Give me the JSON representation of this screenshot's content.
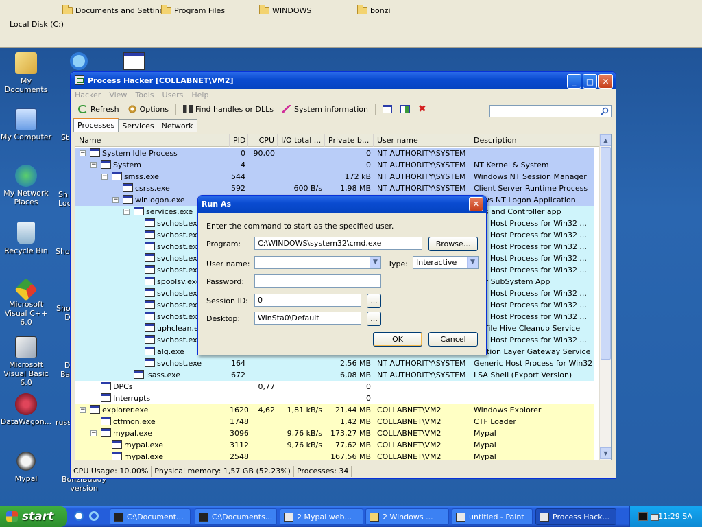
{
  "bg_explorer": {
    "folders": [
      "Documents and Settings",
      "Program Files",
      "WINDOWS",
      "bonzi"
    ],
    "local_disk": "Local Disk (C:)"
  },
  "desktop_icons": [
    {
      "label": "My Documents",
      "icon": "my-documents-icon"
    },
    {
      "label": "My Computer",
      "icon": "my-computer-icon"
    },
    {
      "label": "My Network Places",
      "icon": "network-places-icon"
    },
    {
      "label": "Recycle Bin",
      "icon": "recycle-bin-icon"
    },
    {
      "label": "Microsoft Visual C++ 6.0",
      "icon": "visual-cpp-icon"
    },
    {
      "label": "Microsoft Visual Basic 6.0",
      "icon": "visual-basic-icon"
    },
    {
      "label": "DataWagon...",
      "icon": "datawagon-icon"
    },
    {
      "label": "Mypal",
      "icon": "mypal-icon"
    }
  ],
  "partial_desktop_labels": {
    "st": "St",
    "sh_loc": "Sh\nLoc",
    "sho": "Sho",
    "sho_d": "Sho\nD",
    "d_ba": "D\nBa",
    "russ": "russ",
    "bonzi_version": "BonziBuddy\nversion"
  },
  "process_hacker": {
    "title": "Process Hacker [COLLABNET\\VM2]",
    "menu": [
      "Hacker",
      "View",
      "Tools",
      "Users",
      "Help"
    ],
    "toolbar": {
      "refresh": "Refresh",
      "options": "Options",
      "find_handles": "Find handles or DLLs",
      "system_info": "System information"
    },
    "search_placeholder": "",
    "tabs": [
      "Processes",
      "Services",
      "Network"
    ],
    "columns": [
      "Name",
      "PID",
      "CPU",
      "I/O total ...",
      "Private b...",
      "User name",
      "Description"
    ],
    "rows": [
      {
        "indent": 0,
        "toggle": "−",
        "name": "System Idle Process",
        "pid": "0",
        "cpu": "90,00",
        "io": "",
        "priv": "0",
        "user": "NT AUTHORITY\\SYSTEM",
        "desc": "",
        "bg": "blue"
      },
      {
        "indent": 1,
        "toggle": "−",
        "name": "System",
        "pid": "4",
        "cpu": "",
        "io": "",
        "priv": "0",
        "user": "NT AUTHORITY\\SYSTEM",
        "desc": "NT Kernel & System",
        "bg": "blue"
      },
      {
        "indent": 2,
        "toggle": "−",
        "name": "smss.exe",
        "pid": "544",
        "cpu": "",
        "io": "",
        "priv": "172 kB",
        "user": "NT AUTHORITY\\SYSTEM",
        "desc": "Windows NT Session Manager",
        "bg": "blue"
      },
      {
        "indent": 3,
        "toggle": "",
        "name": "csrss.exe",
        "pid": "592",
        "cpu": "",
        "io": "600 B/s",
        "priv": "1,98 MB",
        "user": "NT AUTHORITY\\SYSTEM",
        "desc": "Client Server Runtime Process",
        "bg": "blue"
      },
      {
        "indent": 3,
        "toggle": "−",
        "name": "winlogon.exe",
        "pid": "",
        "cpu": "",
        "io": "",
        "priv": "",
        "user": "",
        "desc": "dows NT Logon Application",
        "bg": "blue"
      },
      {
        "indent": 4,
        "toggle": "−",
        "name": "services.exe",
        "pid": "",
        "cpu": "",
        "io": "",
        "priv": "",
        "user": "",
        "desc": "ices and Controller app",
        "bg": "cyan"
      },
      {
        "indent": 5,
        "toggle": "",
        "name": "svchost.exe",
        "pid": "",
        "cpu": "",
        "io": "",
        "priv": "",
        "user": "",
        "desc": "eric Host Process for Win32 ...",
        "bg": "cyan"
      },
      {
        "indent": 5,
        "toggle": "",
        "name": "svchost.exe",
        "pid": "",
        "cpu": "",
        "io": "",
        "priv": "",
        "user": "",
        "desc": "eric Host Process for Win32 ...",
        "bg": "cyan"
      },
      {
        "indent": 5,
        "toggle": "",
        "name": "svchost.exe",
        "pid": "",
        "cpu": "",
        "io": "",
        "priv": "",
        "user": "",
        "desc": "eric Host Process for Win32 ...",
        "bg": "cyan"
      },
      {
        "indent": 5,
        "toggle": "",
        "name": "svchost.exe",
        "pid": "",
        "cpu": "",
        "io": "",
        "priv": "",
        "user": "",
        "desc": "eric Host Process for Win32 ...",
        "bg": "cyan"
      },
      {
        "indent": 5,
        "toggle": "",
        "name": "svchost.exe",
        "pid": "",
        "cpu": "",
        "io": "",
        "priv": "",
        "user": "",
        "desc": "eric Host Process for Win32 ...",
        "bg": "cyan"
      },
      {
        "indent": 5,
        "toggle": "",
        "name": "spoolsv.exe",
        "pid": "",
        "cpu": "",
        "io": "",
        "priv": "",
        "user": "",
        "desc": "oler SubSystem App",
        "bg": "cyan"
      },
      {
        "indent": 5,
        "toggle": "",
        "name": "svchost.exe",
        "pid": "",
        "cpu": "",
        "io": "",
        "priv": "",
        "user": "",
        "desc": "eric Host Process for Win32 ...",
        "bg": "cyan"
      },
      {
        "indent": 5,
        "toggle": "",
        "name": "svchost.exe",
        "pid": "",
        "cpu": "",
        "io": "",
        "priv": "",
        "user": "",
        "desc": "eric Host Process for Win32 ...",
        "bg": "cyan"
      },
      {
        "indent": 5,
        "toggle": "",
        "name": "svchost.exe",
        "pid": "",
        "cpu": "",
        "io": "",
        "priv": "",
        "user": "",
        "desc": "eric Host Process for Win32 ...",
        "bg": "cyan"
      },
      {
        "indent": 5,
        "toggle": "",
        "name": "uphclean.exe",
        "pid": "",
        "cpu": "",
        "io": "",
        "priv": "",
        "user": "",
        "desc": "Profile Hive Cleanup Service",
        "bg": "cyan"
      },
      {
        "indent": 5,
        "toggle": "",
        "name": "svchost.exe",
        "pid": "",
        "cpu": "",
        "io": "",
        "priv": "",
        "user": "",
        "desc": "eric Host Process for Win32 ...",
        "bg": "cyan"
      },
      {
        "indent": 5,
        "toggle": "",
        "name": "alg.exe",
        "pid": "",
        "cpu": "",
        "io": "",
        "priv": "",
        "user": "",
        "desc": "lication Layer Gateway Service",
        "bg": "cyan"
      },
      {
        "indent": 5,
        "toggle": "",
        "name": "svchost.exe",
        "pid": "164",
        "cpu": "",
        "io": "",
        "priv": "2,56 MB",
        "user": "NT AUTHORITY\\SYSTEM",
        "desc": "Generic Host Process for Win32 ...",
        "bg": "cyan"
      },
      {
        "indent": 4,
        "toggle": "",
        "name": "lsass.exe",
        "pid": "672",
        "cpu": "",
        "io": "",
        "priv": "6,08 MB",
        "user": "NT AUTHORITY\\SYSTEM",
        "desc": "LSA Shell (Export Version)",
        "bg": "cyan"
      },
      {
        "indent": 1,
        "toggle": "",
        "name": "DPCs",
        "pid": "",
        "cpu": "0,77",
        "io": "",
        "priv": "0",
        "user": "",
        "desc": "",
        "bg": "white"
      },
      {
        "indent": 1,
        "toggle": "",
        "name": "Interrupts",
        "pid": "",
        "cpu": "",
        "io": "",
        "priv": "0",
        "user": "",
        "desc": "",
        "bg": "white"
      },
      {
        "indent": 0,
        "toggle": "−",
        "name": "explorer.exe",
        "pid": "1620",
        "cpu": "4,62",
        "io": "1,81 kB/s",
        "priv": "21,44 MB",
        "user": "COLLABNET\\VM2",
        "desc": "Windows Explorer",
        "bg": "yellow"
      },
      {
        "indent": 1,
        "toggle": "",
        "name": "ctfmon.exe",
        "pid": "1748",
        "cpu": "",
        "io": "",
        "priv": "1,42 MB",
        "user": "COLLABNET\\VM2",
        "desc": "CTF Loader",
        "bg": "yellow"
      },
      {
        "indent": 1,
        "toggle": "−",
        "name": "mypal.exe",
        "pid": "3096",
        "cpu": "",
        "io": "9,76 kB/s",
        "priv": "173,27 MB",
        "user": "COLLABNET\\VM2",
        "desc": "Mypal",
        "bg": "yellow"
      },
      {
        "indent": 2,
        "toggle": "",
        "name": "mypal.exe",
        "pid": "3112",
        "cpu": "",
        "io": "9,76 kB/s",
        "priv": "77,62 MB",
        "user": "COLLABNET\\VM2",
        "desc": "Mypal",
        "bg": "yellow"
      },
      {
        "indent": 2,
        "toggle": "",
        "name": "mypal.exe",
        "pid": "2548",
        "cpu": "",
        "io": "",
        "priv": "167,56 MB",
        "user": "COLLABNET\\VM2",
        "desc": "Mypal",
        "bg": "yellow"
      }
    ],
    "status": {
      "cpu": "CPU Usage: 10.00%",
      "memory": "Physical memory: 1,57 GB (52.23%)",
      "processes": "Processes: 34"
    }
  },
  "run_as": {
    "title": "Run As",
    "intro": "Enter the command to start as the specified user.",
    "program_label": "Program:",
    "program_value": "C:\\WINDOWS\\system32\\cmd.exe",
    "browse": "Browse...",
    "username_label": "User name:",
    "username_value": "",
    "type_label": "Type:",
    "type_value": "Interactive",
    "password_label": "Password:",
    "session_label": "Session ID:",
    "session_value": "0",
    "desktop_label": "Desktop:",
    "desktop_value": "WinSta0\\Default",
    "ellipsis": "...",
    "ok": "OK",
    "cancel": "Cancel"
  },
  "taskbar": {
    "start": "start",
    "tasks": [
      {
        "label": "C:\\Document...",
        "active": false
      },
      {
        "label": "C:\\Documents...",
        "active": false
      },
      {
        "label": "2 Mypal web...",
        "active": false
      },
      {
        "label": "2 Windows ...",
        "active": false
      },
      {
        "label": "untitled - Paint",
        "active": false
      },
      {
        "label": "Process Hack...",
        "active": true
      }
    ],
    "clock": "11:29 SA"
  },
  "colors": {
    "xp_blue": "#0a4bd0",
    "row_blue": "#b9cdf8",
    "row_cyan": "#cff4fb",
    "row_yellow": "#ffffc4",
    "start_green": "#3fae3f"
  }
}
